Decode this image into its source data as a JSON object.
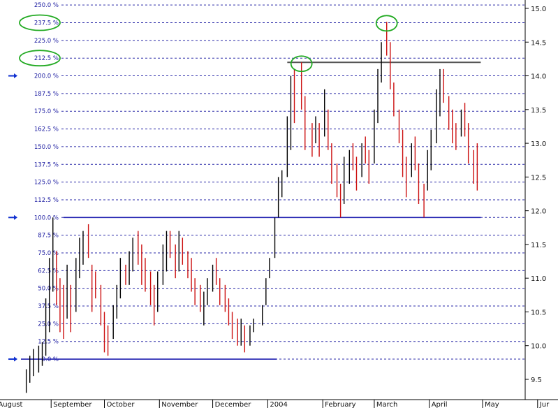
{
  "chart_data": {
    "type": "bar",
    "subtype": "ohlc-price-chart",
    "title": "",
    "xlabel": "",
    "ylabel": "",
    "y_right": {
      "min": 9.3,
      "max": 15.1,
      "ticks": [
        9.5,
        10.0,
        10.5,
        11.0,
        11.5,
        12.0,
        12.5,
        13.0,
        13.5,
        14.0,
        14.5,
        15.0
      ],
      "tick_labels": [
        "9.5",
        "10.0",
        "10.5",
        "11.0",
        "11.5",
        "12.0",
        "12.5",
        "13.0",
        "13.5",
        "14.0",
        "14.5",
        "15.0"
      ]
    },
    "y_left_percent": {
      "anchor_0_price": 9.8,
      "anchor_100_price": 11.9,
      "levels": [
        0,
        12.5,
        25,
        37.5,
        50,
        62.5,
        75,
        87.5,
        100,
        112.5,
        125,
        137.5,
        150,
        162.5,
        175,
        187.5,
        200,
        212.5,
        225,
        237.5,
        250
      ],
      "labels": [
        "0.0 %",
        "12.5 %",
        "25.0 %",
        "37.5 %",
        "50.0 %",
        "62.5 %",
        "75.0 %",
        "87.5 %",
        "100.0 %",
        "112.5 %",
        "125.0 %",
        "137.5 %",
        "150.0 %",
        "162.5 %",
        "175.0 %",
        "187.5 %",
        "200.0 %",
        "212.5 %",
        "225.0 %",
        "237.5 %",
        "250.0 %"
      ],
      "arrow_marked_levels": [
        0,
        100,
        200
      ],
      "circled_levels": [
        212.5,
        237.5
      ]
    },
    "x_axis": {
      "start": "2003-08-15",
      "end": "2004-05-25",
      "months": [
        {
          "label": "August",
          "date": "2003-08-01"
        },
        {
          "label": "September",
          "date": "2003-09-01"
        },
        {
          "label": "October",
          "date": "2003-10-01"
        },
        {
          "label": "November",
          "date": "2003-11-01"
        },
        {
          "label": "December",
          "date": "2003-12-01"
        },
        {
          "label": "2004",
          "date": "2004-01-01"
        },
        {
          "label": "February",
          "date": "2004-02-01"
        },
        {
          "label": "March",
          "date": "2004-03-01"
        },
        {
          "label": "April",
          "date": "2004-04-01"
        },
        {
          "label": "May",
          "date": "2004-05-01"
        },
        {
          "label": "Jur",
          "date": "2004-06-01"
        }
      ]
    },
    "horizontal_lines": [
      {
        "price": 11.9,
        "color": "#2020b0",
        "from": "2003-09-08",
        "to": "2004-04-30"
      },
      {
        "price": 9.8,
        "color": "#2020b0",
        "from": "2003-08-15",
        "to": "2004-01-06"
      },
      {
        "price": 14.2,
        "color": "#555555",
        "from": "2004-01-12",
        "to": "2004-04-30"
      }
    ],
    "circled_peaks": [
      {
        "date": "2004-01-20",
        "price": 14.2
      },
      {
        "date": "2004-03-08",
        "price": 14.8
      }
    ],
    "series": [
      {
        "bars": [
          [
            "2003-08-18",
            9.3,
            9.65,
            "up"
          ],
          [
            "2003-08-20",
            9.45,
            9.85,
            "up"
          ],
          [
            "2003-08-22",
            9.55,
            9.95,
            "up"
          ],
          [
            "2003-08-25",
            9.6,
            10.0,
            "up"
          ],
          [
            "2003-08-27",
            9.7,
            10.05,
            "up"
          ],
          [
            "2003-08-29",
            9.85,
            10.7,
            "up"
          ],
          [
            "2003-08-31",
            10.2,
            11.3,
            "up"
          ],
          [
            "2003-09-02",
            10.8,
            11.9,
            "up"
          ],
          [
            "2003-09-04",
            10.6,
            11.4,
            "down"
          ],
          [
            "2003-09-06",
            10.2,
            11.0,
            "down"
          ],
          [
            "2003-09-08",
            10.1,
            10.9,
            "down"
          ],
          [
            "2003-09-10",
            10.4,
            11.2,
            "up"
          ],
          [
            "2003-09-12",
            10.2,
            10.9,
            "down"
          ],
          [
            "2003-09-15",
            10.5,
            11.3,
            "up"
          ],
          [
            "2003-09-17",
            11.0,
            11.6,
            "up"
          ],
          [
            "2003-09-19",
            11.2,
            11.7,
            "up"
          ],
          [
            "2003-09-22",
            11.3,
            11.8,
            "down"
          ],
          [
            "2003-09-24",
            10.5,
            11.2,
            "down"
          ],
          [
            "2003-09-26",
            10.7,
            11.1,
            "down"
          ],
          [
            "2003-09-29",
            10.3,
            10.9,
            "down"
          ],
          [
            "2003-10-01",
            9.9,
            10.5,
            "down"
          ],
          [
            "2003-10-03",
            9.85,
            10.3,
            "down"
          ],
          [
            "2003-10-06",
            10.1,
            10.6,
            "up"
          ],
          [
            "2003-10-08",
            10.4,
            10.9,
            "up"
          ],
          [
            "2003-10-10",
            10.7,
            11.3,
            "up"
          ],
          [
            "2003-10-13",
            10.9,
            11.2,
            "down"
          ],
          [
            "2003-10-15",
            10.9,
            11.4,
            "up"
          ],
          [
            "2003-10-17",
            11.1,
            11.6,
            "up"
          ],
          [
            "2003-10-20",
            11.2,
            11.7,
            "down"
          ],
          [
            "2003-10-22",
            10.9,
            11.5,
            "down"
          ],
          [
            "2003-10-24",
            10.8,
            11.3,
            "down"
          ],
          [
            "2003-10-27",
            10.6,
            11.1,
            "down"
          ],
          [
            "2003-10-29",
            10.3,
            10.9,
            "down"
          ],
          [
            "2003-10-31",
            10.5,
            11.1,
            "up"
          ],
          [
            "2003-11-03",
            10.9,
            11.5,
            "up"
          ],
          [
            "2003-11-05",
            11.1,
            11.7,
            "up"
          ],
          [
            "2003-11-07",
            11.3,
            11.7,
            "down"
          ],
          [
            "2003-11-10",
            11.0,
            11.5,
            "down"
          ],
          [
            "2003-11-12",
            11.1,
            11.7,
            "up"
          ],
          [
            "2003-11-14",
            11.2,
            11.6,
            "down"
          ],
          [
            "2003-11-17",
            11.0,
            11.4,
            "down"
          ],
          [
            "2003-11-19",
            10.8,
            11.3,
            "down"
          ],
          [
            "2003-11-21",
            10.6,
            11.0,
            "down"
          ],
          [
            "2003-11-24",
            10.5,
            10.9,
            "down"
          ],
          [
            "2003-11-26",
            10.3,
            10.8,
            "up"
          ],
          [
            "2003-11-28",
            10.6,
            11.0,
            "up"
          ],
          [
            "2003-12-01",
            10.8,
            11.2,
            "up"
          ],
          [
            "2003-12-03",
            10.9,
            11.3,
            "down"
          ],
          [
            "2003-12-05",
            10.6,
            11.0,
            "down"
          ],
          [
            "2003-12-08",
            10.5,
            10.9,
            "down"
          ],
          [
            "2003-12-10",
            10.3,
            10.7,
            "down"
          ],
          [
            "2003-12-12",
            10.1,
            10.5,
            "down"
          ],
          [
            "2003-12-15",
            10.0,
            10.4,
            "down"
          ],
          [
            "2003-12-17",
            10.0,
            10.4,
            "up"
          ],
          [
            "2003-12-19",
            9.9,
            10.3,
            "down"
          ],
          [
            "2003-12-22",
            10.0,
            10.3,
            "up"
          ],
          [
            "2003-12-24",
            10.2,
            10.4,
            "up"
          ],
          [
            "2003-12-29",
            10.3,
            10.6,
            "up"
          ],
          [
            "2003-12-31",
            10.6,
            11.0,
            "up"
          ],
          [
            "2004-01-02",
            11.0,
            11.3,
            "up"
          ],
          [
            "2004-01-05",
            11.3,
            11.9,
            "up"
          ],
          [
            "2004-01-07",
            11.9,
            12.5,
            "up"
          ],
          [
            "2004-01-09",
            12.2,
            12.6,
            "up"
          ],
          [
            "2004-01-12",
            12.5,
            13.4,
            "up"
          ],
          [
            "2004-01-14",
            12.9,
            14.0,
            "up"
          ],
          [
            "2004-01-16",
            13.3,
            14.1,
            "down"
          ],
          [
            "2004-01-20",
            13.5,
            14.2,
            "down"
          ],
          [
            "2004-01-22",
            12.9,
            13.7,
            "down"
          ],
          [
            "2004-01-26",
            12.8,
            13.3,
            "down"
          ],
          [
            "2004-01-28",
            13.0,
            13.4,
            "up"
          ],
          [
            "2004-01-30",
            12.8,
            13.3,
            "down"
          ],
          [
            "2004-02-02",
            13.1,
            13.8,
            "up"
          ],
          [
            "2004-02-04",
            12.9,
            13.5,
            "down"
          ],
          [
            "2004-02-06",
            12.4,
            13.0,
            "down"
          ],
          [
            "2004-02-09",
            12.2,
            12.7,
            "down"
          ],
          [
            "2004-02-11",
            11.9,
            12.4,
            "down"
          ],
          [
            "2004-02-13",
            12.1,
            12.8,
            "up"
          ],
          [
            "2004-02-16",
            12.4,
            12.9,
            "up"
          ],
          [
            "2004-02-18",
            12.6,
            13.0,
            "down"
          ],
          [
            "2004-02-20",
            12.3,
            12.8,
            "down"
          ],
          [
            "2004-02-23",
            12.5,
            13.0,
            "up"
          ],
          [
            "2004-02-25",
            12.7,
            13.1,
            "down"
          ],
          [
            "2004-02-27",
            12.4,
            12.9,
            "down"
          ],
          [
            "2004-03-01",
            12.7,
            13.5,
            "up"
          ],
          [
            "2004-03-03",
            13.3,
            14.1,
            "up"
          ],
          [
            "2004-03-05",
            13.9,
            14.5,
            "up"
          ],
          [
            "2004-03-08",
            14.3,
            14.8,
            "down"
          ],
          [
            "2004-03-10",
            13.8,
            14.5,
            "down"
          ],
          [
            "2004-03-12",
            13.4,
            13.9,
            "down"
          ],
          [
            "2004-03-15",
            13.0,
            13.5,
            "down"
          ],
          [
            "2004-03-17",
            12.5,
            13.2,
            "down"
          ],
          [
            "2004-03-19",
            12.2,
            12.8,
            "down"
          ],
          [
            "2004-03-22",
            12.5,
            13.0,
            "up"
          ],
          [
            "2004-03-24",
            12.6,
            13.1,
            "down"
          ],
          [
            "2004-03-26",
            12.1,
            12.7,
            "down"
          ],
          [
            "2004-03-29",
            11.9,
            12.4,
            "down"
          ],
          [
            "2004-03-31",
            12.3,
            12.9,
            "up"
          ],
          [
            "2004-04-02",
            12.6,
            13.2,
            "up"
          ],
          [
            "2004-04-05",
            13.0,
            13.8,
            "up"
          ],
          [
            "2004-04-07",
            13.4,
            14.1,
            "up"
          ],
          [
            "2004-04-09",
            13.6,
            14.1,
            "down"
          ],
          [
            "2004-04-12",
            13.2,
            13.7,
            "down"
          ],
          [
            "2004-04-14",
            13.0,
            13.5,
            "down"
          ],
          [
            "2004-04-16",
            12.9,
            13.3,
            "down"
          ],
          [
            "2004-04-19",
            13.1,
            13.5,
            "up"
          ],
          [
            "2004-04-21",
            13.1,
            13.6,
            "down"
          ],
          [
            "2004-04-23",
            12.7,
            13.3,
            "down"
          ],
          [
            "2004-04-26",
            12.4,
            12.9,
            "down"
          ],
          [
            "2004-04-28",
            12.3,
            13.0,
            "down"
          ]
        ]
      }
    ],
    "grid": true,
    "grid_style": "dashed horizontal at each 12.5 % level",
    "legend": "none",
    "colors": {
      "up_bar": "#000000",
      "down_bar": "#cc1010",
      "pct_lines": "#2a2aa8",
      "support_lines": "#2020b0",
      "resistance_line": "#555555",
      "circle": "#22aa22",
      "arrow": "#1030d0"
    }
  }
}
